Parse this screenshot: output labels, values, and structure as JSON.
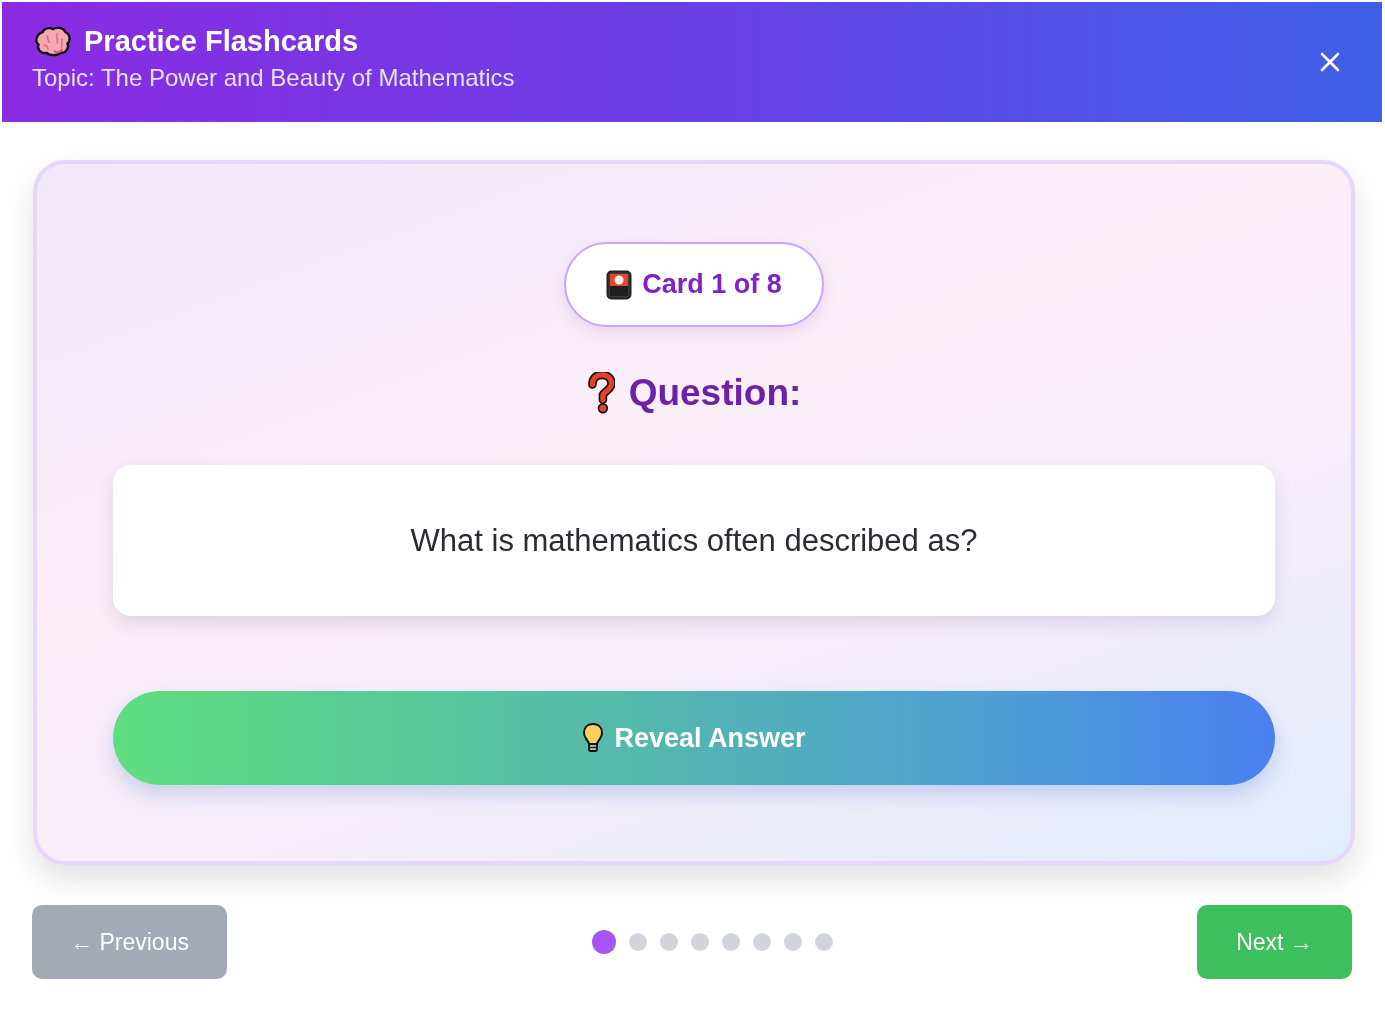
{
  "header": {
    "title": "Practice Flashcards",
    "subtitle": "Topic: The Power and Beauty of Mathematics"
  },
  "card": {
    "counter": "Card 1 of 8",
    "heading": "Question:",
    "question": "What is mathematics often described as?",
    "reveal_button": "Reveal Answer"
  },
  "navigation": {
    "previous": {
      "label": "← Previous",
      "disabled": true
    },
    "dots": [
      {
        "selected": true
      },
      {
        "selected": false
      },
      {
        "selected": false
      },
      {
        "selected": false
      },
      {
        "selected": false
      },
      {
        "selected": false
      },
      {
        "selected": false
      },
      {
        "selected": false
      }
    ],
    "next": {
      "label": "Next →",
      "disabled": false
    }
  }
}
